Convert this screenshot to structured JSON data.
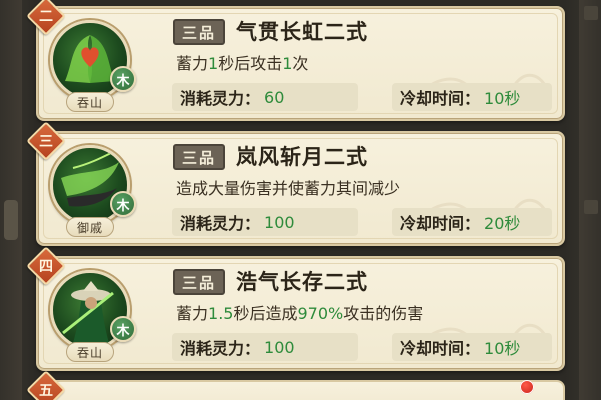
{
  "skills": [
    {
      "rank": "二",
      "grade": "三品",
      "title": "气贯长虹二式",
      "desc_parts": [
        {
          "text": "蓄力",
          "hl": false
        },
        {
          "text": "1",
          "hl": true
        },
        {
          "text": "秒后攻击",
          "hl": false
        },
        {
          "text": "1",
          "hl": true
        },
        {
          "text": "次",
          "hl": false
        }
      ],
      "element": "木",
      "sect": "吞山",
      "icon": "heart-vortex-icon",
      "cost_label": "消耗灵力：",
      "cost_value": "60",
      "cd_label": "冷却时间：",
      "cd_value": "10秒"
    },
    {
      "rank": "三",
      "grade": "三品",
      "title": "岚风斩月二式",
      "desc_parts": [
        {
          "text": "造成大量伤害并使蓄力其间减少",
          "hl": false
        }
      ],
      "element": "木",
      "sect": "御戚",
      "icon": "wind-blade-icon",
      "cost_label": "消耗灵力：",
      "cost_value": "100",
      "cd_label": "冷却时间：",
      "cd_value": "20秒"
    },
    {
      "rank": "四",
      "grade": "三品",
      "title": "浩气长存二式",
      "desc_parts": [
        {
          "text": "蓄力",
          "hl": false
        },
        {
          "text": "1.5",
          "hl": true
        },
        {
          "text": "秒后造成",
          "hl": false
        },
        {
          "text": "970%",
          "hl": true
        },
        {
          "text": "攻击的伤害",
          "hl": false
        }
      ],
      "element": "木",
      "sect": "吞山",
      "icon": "swordsman-icon",
      "cost_label": "消耗灵力：",
      "cost_value": "100",
      "cd_label": "冷却时间：",
      "cd_value": "10秒"
    }
  ],
  "next_rank": "五",
  "colors": {
    "highlight": "#2e8b3b",
    "card_bg": "#f4ecd5",
    "badge": "#c4532a"
  }
}
